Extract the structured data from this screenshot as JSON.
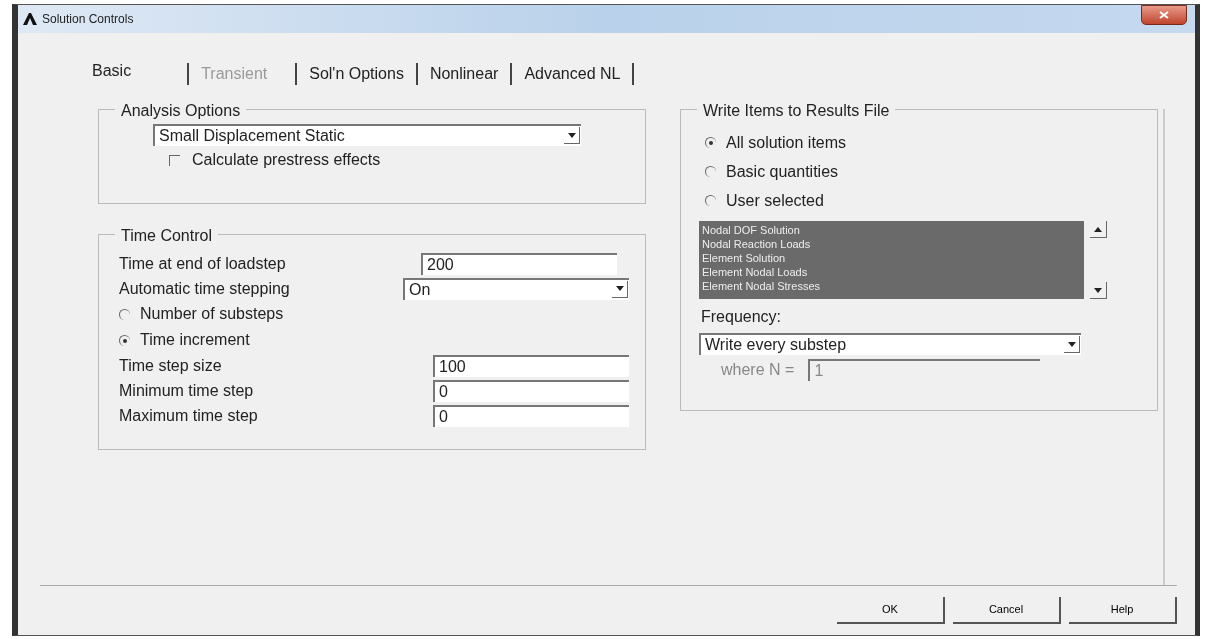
{
  "window": {
    "title": "Solution Controls"
  },
  "tabs": [
    {
      "label": "Basic",
      "selected": true,
      "disabled": false
    },
    {
      "label": "Transient",
      "selected": false,
      "disabled": true
    },
    {
      "label": "Sol'n Options",
      "selected": false,
      "disabled": false
    },
    {
      "label": "Nonlinear",
      "selected": false,
      "disabled": false
    },
    {
      "label": "Advanced NL",
      "selected": false,
      "disabled": false
    }
  ],
  "analysis_options": {
    "title": "Analysis Options",
    "analysis_type": {
      "value": "Small Displacement Static"
    },
    "prestress": {
      "label": "Calculate prestress effects",
      "checked": false
    }
  },
  "time_control": {
    "title": "Time Control",
    "rows": [
      {
        "kind": "field",
        "label": "Time at end of loadstep",
        "value": "200"
      },
      {
        "kind": "dropdown",
        "label": "Automatic time stepping",
        "value": "On"
      },
      {
        "kind": "radio",
        "label": "Number of substeps",
        "selected": false
      },
      {
        "kind": "radio",
        "label": "Time increment",
        "selected": true
      },
      {
        "kind": "field",
        "label": "Time step size",
        "value": "100"
      },
      {
        "kind": "field",
        "label": "Minimum time step",
        "value": "0"
      },
      {
        "kind": "field",
        "label": "Maximum time step",
        "value": "0"
      }
    ]
  },
  "write_items": {
    "title": "Write Items to Results File",
    "options": [
      {
        "label": "All solution items",
        "selected": true
      },
      {
        "label": "Basic quantities",
        "selected": false
      },
      {
        "label": "User selected",
        "selected": false
      }
    ],
    "items": [
      {
        "label": "Nodal DOF Solution",
        "selected": true
      },
      {
        "label": "Nodal Reaction Loads",
        "selected": true
      },
      {
        "label": "Element Solution",
        "selected": true
      },
      {
        "label": "Element Nodal Loads",
        "selected": true
      },
      {
        "label": "Element Nodal Stresses",
        "selected": true
      }
    ],
    "frequency_label": "Frequency:",
    "frequency": {
      "value": "Write every substep"
    },
    "where_n": {
      "label": "where N =",
      "value": "1",
      "disabled": true
    }
  },
  "buttons": [
    "OK",
    "Cancel",
    "Help"
  ]
}
